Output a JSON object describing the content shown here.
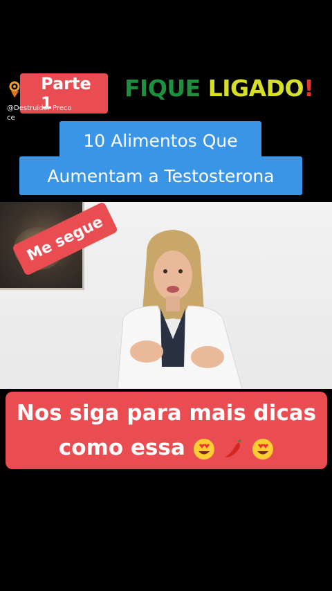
{
  "overlay": {
    "part_label": "Parte 1",
    "watermark_line1": "@Destruidor Preco",
    "watermark_line2": "ce",
    "headline_word1": "FIQUE",
    "headline_word2": "LIGADO",
    "headline_word3": "!"
  },
  "title": {
    "line1": "10 Alimentos Que",
    "line2": "Aumentam a Testosterona"
  },
  "video": {
    "sticker": "Me segue"
  },
  "follow": {
    "line1": "Nos siga para mais dicas",
    "line2": "como essa"
  },
  "colors": {
    "badge_red": "#e94d52",
    "title_blue": "#3b95e6",
    "headline_green": "#1e8f3d",
    "headline_yellow": "#d7e024",
    "headline_red": "#e23a2c"
  },
  "icons": [
    "brand-logo-icon",
    "heart-eyes-emoji",
    "chili-pepper-emoji",
    "heart-eyes-emoji"
  ]
}
